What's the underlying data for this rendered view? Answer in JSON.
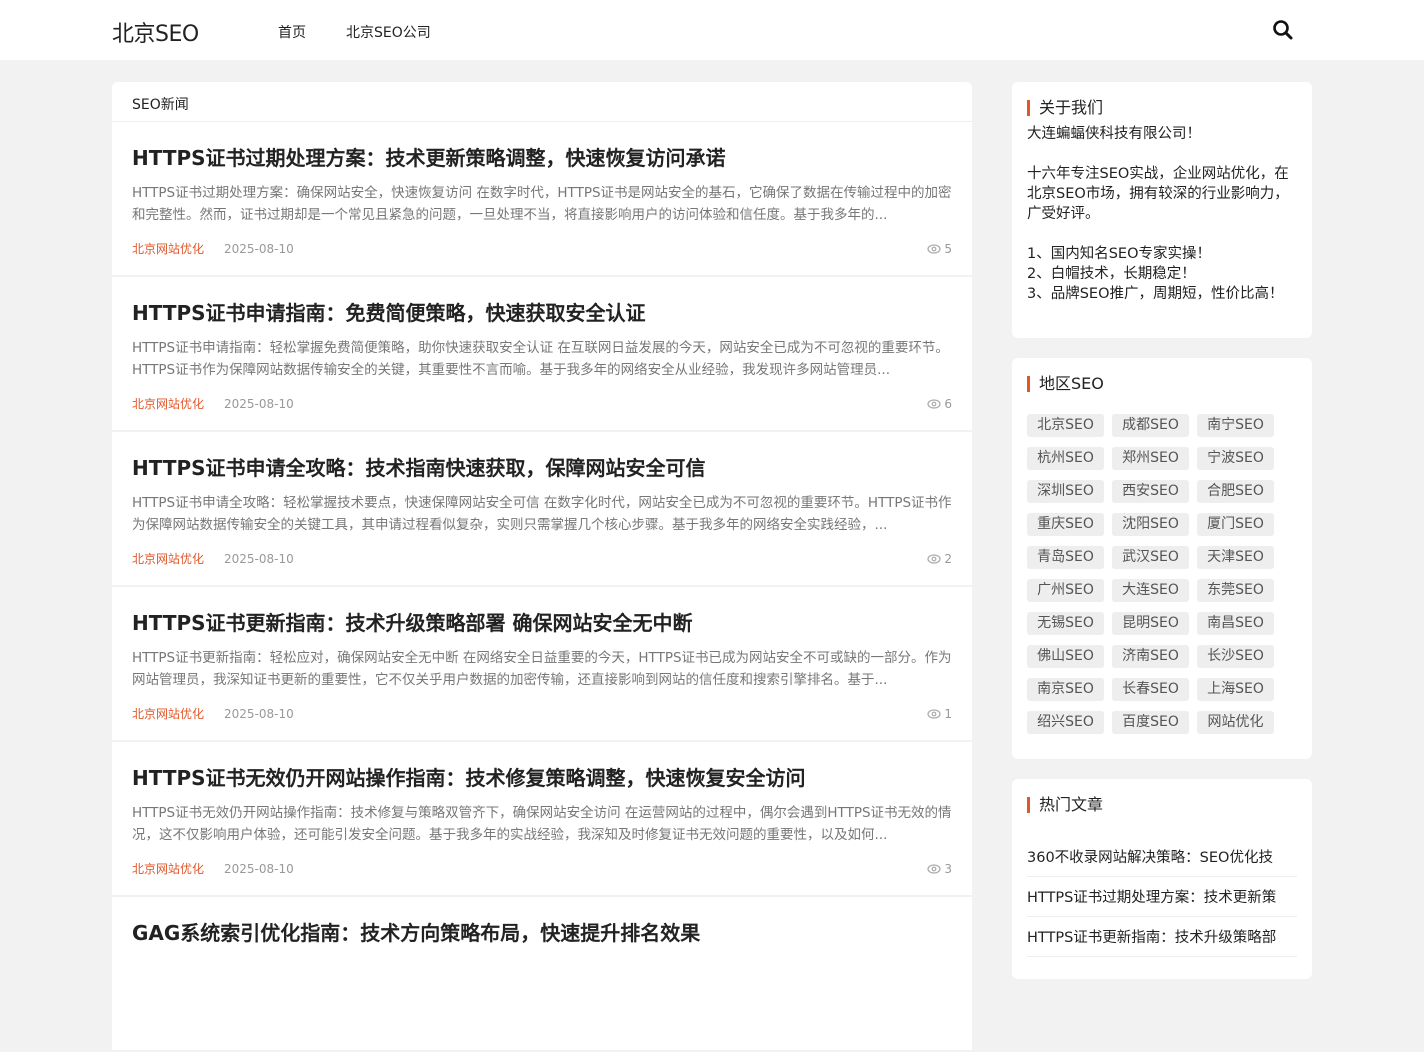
{
  "header": {
    "logo": "北京SEO",
    "nav": [
      "首页",
      "北京SEO公司"
    ]
  },
  "main": {
    "section_title": "SEO新闻",
    "posts": [
      {
        "title": "HTTPS证书过期处理方案：技术更新策略调整，快速恢复访问承诺",
        "excerpt": "HTTPS证书过期处理方案：确保网站安全，快速恢复访问 在数字时代，HTTPS证书是网站安全的基石，它确保了数据在传输过程中的加密和完整性。然而，证书过期却是一个常见且紧急的问题，一旦处理不当，将直接影响用户的访问体验和信任度。基于我多年的...",
        "category": "北京网站优化",
        "date": "2025-08-10",
        "views": "5"
      },
      {
        "title": "HTTPS证书申请指南：免费简便策略，快速获取安全认证",
        "excerpt": "HTTPS证书申请指南：轻松掌握免费简便策略，助你快速获取安全认证 在互联网日益发展的今天，网站安全已成为不可忽视的重要环节。HTTPS证书作为保障网站数据传输安全的关键，其重要性不言而喻。基于我多年的网络安全从业经验，我发现许多网站管理员...",
        "category": "北京网站优化",
        "date": "2025-08-10",
        "views": "6"
      },
      {
        "title": "HTTPS证书申请全攻略：技术指南快速获取，保障网站安全可信",
        "excerpt": "HTTPS证书申请全攻略：轻松掌握技术要点，快速保障网站安全可信 在数字化时代，网站安全已成为不可忽视的重要环节。HTTPS证书作为保障网站数据传输安全的关键工具，其申请过程看似复杂，实则只需掌握几个核心步骤。基于我多年的网络安全实践经验，...",
        "category": "北京网站优化",
        "date": "2025-08-10",
        "views": "2"
      },
      {
        "title": "HTTPS证书更新指南：技术升级策略部署 确保网站安全无中断",
        "excerpt": "HTTPS证书更新指南：轻松应对，确保网站安全无中断 在网络安全日益重要的今天，HTTPS证书已成为网站安全不可或缺的一部分。作为网站管理员，我深知证书更新的重要性，它不仅关乎用户数据的加密传输，还直接影响到网站的信任度和搜索引擎排名。基于...",
        "category": "北京网站优化",
        "date": "2025-08-10",
        "views": "1"
      },
      {
        "title": "HTTPS证书无效仍开网站操作指南：技术修复策略调整，快速恢复安全访问",
        "excerpt": "HTTPS证书无效仍开网站操作指南：技术修复与策略双管齐下，确保网站安全访问 在运营网站的过程中，偶尔会遇到HTTPS证书无效的情况，这不仅影响用户体验，还可能引发安全问题。基于我多年的实战经验，我深知及时修复证书无效问题的重要性，以及如何...",
        "category": "北京网站优化",
        "date": "2025-08-10",
        "views": "3"
      },
      {
        "title": "GAG系统索引优化指南：技术方向策略布局，快速提升排名效果",
        "excerpt": "",
        "category": "",
        "date": "",
        "views": ""
      }
    ]
  },
  "sidebar": {
    "about": {
      "title": "关于我们",
      "company": "大连蝙蝠侠科技有限公司！",
      "intro": "十六年专注SEO实战，企业网站优化，在北京SEO市场，拥有较深的行业影响力，广受好评。",
      "points": [
        "1、国内知名SEO专家实操！",
        "2、白帽技术，长期稳定！",
        "3、品牌SEO推广，周期短，性价比高！"
      ]
    },
    "regions": {
      "title": "地区SEO",
      "tags": [
        "北京SEO",
        "成都SEO",
        "南宁SEO",
        "杭州SEO",
        "郑州SEO",
        "宁波SEO",
        "深圳SEO",
        "西安SEO",
        "合肥SEO",
        "重庆SEO",
        "沈阳SEO",
        "厦门SEO",
        "青岛SEO",
        "武汉SEO",
        "天津SEO",
        "广州SEO",
        "大连SEO",
        "东莞SEO",
        "无锡SEO",
        "昆明SEO",
        "南昌SEO",
        "佛山SEO",
        "济南SEO",
        "长沙SEO",
        "南京SEO",
        "长春SEO",
        "上海SEO",
        "绍兴SEO",
        "百度SEO",
        "网站优化"
      ]
    },
    "hot": {
      "title": "热门文章",
      "items": [
        "360不收录网站解决策略：SEO优化技",
        "HTTPS证书过期处理方案：技术更新策",
        "HTTPS证书更新指南：技术升级策略部"
      ]
    }
  },
  "colors": {
    "accent": "#e0582a",
    "background": "#f2f2f2"
  }
}
